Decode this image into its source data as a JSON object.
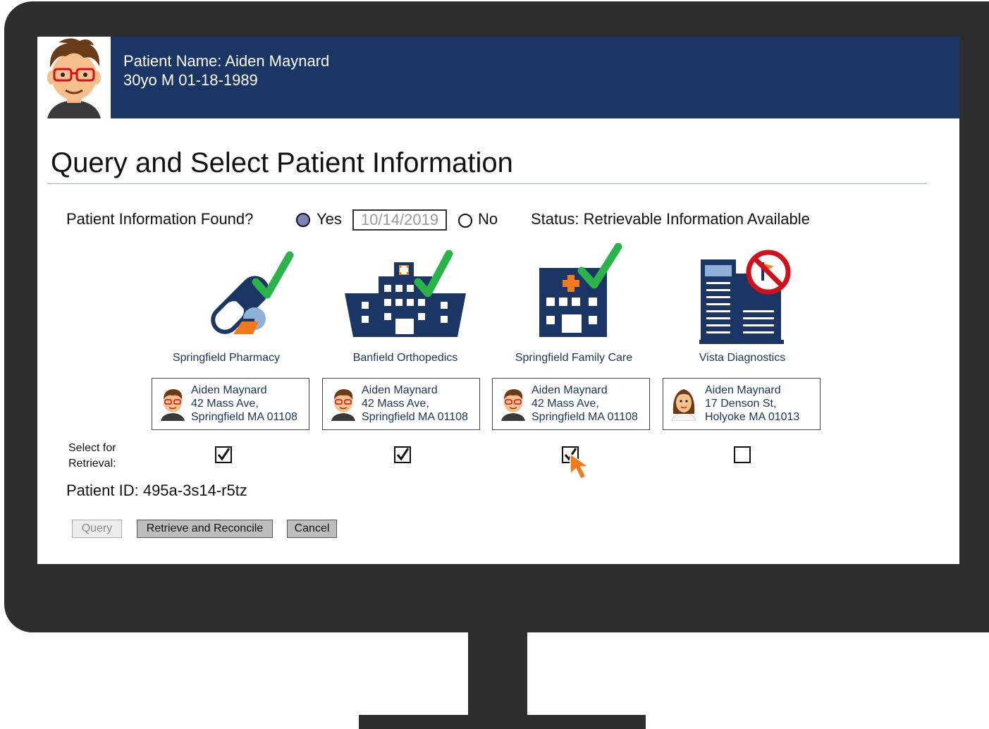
{
  "header": {
    "patient_name": "Patient Name: Aiden Maynard",
    "patient_demographics": "30yo M  01-18-1989"
  },
  "page_title": "Query and Select Patient Information",
  "found": {
    "label": "Patient Information Found?",
    "yes_label": "Yes",
    "yes_selected": true,
    "date_value": "10/14/2019",
    "no_label": "No",
    "status": "Status: Retrievable Information Available"
  },
  "facilities": [
    {
      "name": "Springfield Pharmacy",
      "icon": "pharmacy-pill-icon",
      "badge": "check",
      "card": {
        "name": "Aiden Maynard",
        "address1": "42 Mass Ave,",
        "address2": "Springfield MA 01108"
      },
      "selected": true
    },
    {
      "name": "Banfield Orthopedics",
      "icon": "hospital-building-icon",
      "badge": "check",
      "card": {
        "name": "Aiden Maynard",
        "address1": "42 Mass Ave,",
        "address2": "Springfield MA 01108"
      },
      "selected": true
    },
    {
      "name": "Springfield Family Care",
      "icon": "clinic-building-icon",
      "badge": "check",
      "card": {
        "name": "Aiden Maynard",
        "address1": "42 Mass Ave,",
        "address2": "Springfield MA 01108"
      },
      "selected": true
    },
    {
      "name": "Vista Diagnostics",
      "icon": "office-building-icon",
      "badge": "prohibited",
      "card": {
        "name": "Aiden Maynard",
        "address1": "17 Denson St,",
        "address2": "Holyoke MA 01013"
      },
      "selected": false
    }
  ],
  "select_label": "Select for\nRetrieval:",
  "patient_id": "Patient ID: 495a-3s14-r5tz",
  "buttons": {
    "query": "Query",
    "retrieve": "Retrieve and Reconcile",
    "cancel": "Cancel"
  },
  "colors": {
    "header_bg": "#1b3565",
    "icon_navy": "#1b3565",
    "check_green": "#2bb34a",
    "prohibited_red": "#d0101c",
    "cursor_orange": "#f27a1a"
  }
}
